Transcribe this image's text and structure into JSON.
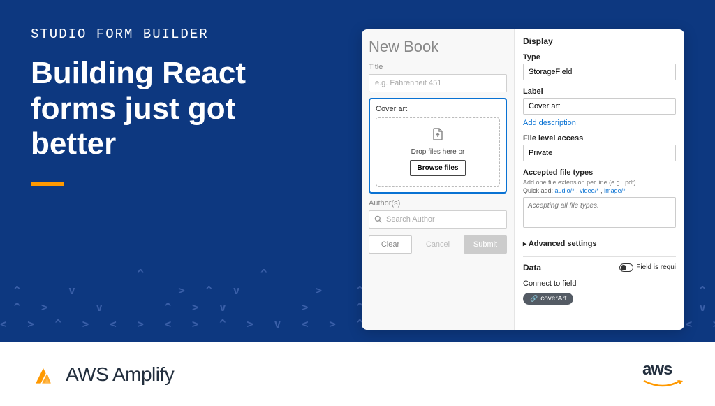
{
  "hero": {
    "eyebrow": "STUDIO FORM BUILDER",
    "headline": "Building React forms just got better"
  },
  "form": {
    "title": "New Book",
    "title_label": "Title",
    "title_placeholder": "e.g. Fahrenheit 451",
    "cover_art_label": "Cover art",
    "dropzone_text": "Drop files here or",
    "browse_button": "Browse files",
    "authors_label": "Author(s)",
    "authors_placeholder": "Search Author",
    "clear_button": "Clear",
    "cancel_button": "Cancel",
    "submit_button": "Submit"
  },
  "config": {
    "display_section": "Display",
    "type_label": "Type",
    "type_value": "StorageField",
    "label_label": "Label",
    "label_value": "Cover art",
    "add_description": "Add description",
    "file_level_label": "File level access",
    "file_level_value": "Private",
    "accepted_types_label": "Accepted file types",
    "accepted_hint": "Add one file extension per line (e.g. .pdf).",
    "quick_add_prefix": "Quick add:",
    "quick_add_audio": "audio/*",
    "quick_add_video": "video/*",
    "quick_add_image": "image/*",
    "accepted_placeholder": "Accepting all file types.",
    "advanced_settings": "Advanced settings",
    "data_section": "Data",
    "field_required": "Field is requi",
    "connect_label": "Connect to field",
    "connect_value": "coverArt"
  },
  "footer": {
    "amplify_name": "AWS Amplify",
    "aws": "aws"
  }
}
